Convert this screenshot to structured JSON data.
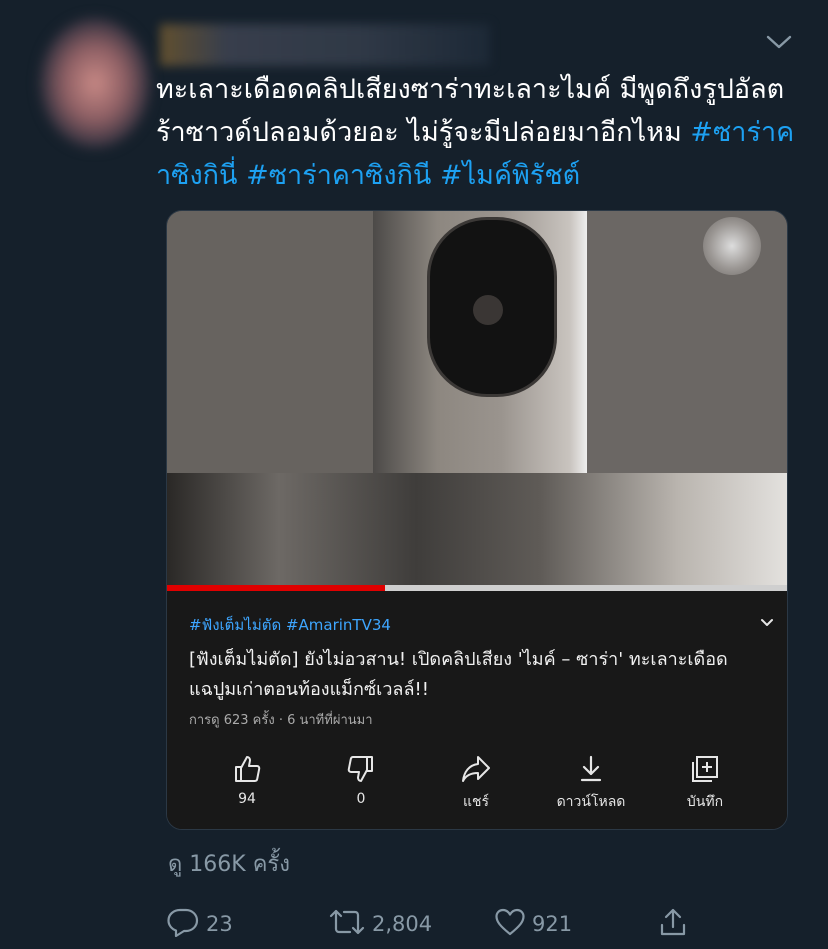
{
  "tweet": {
    "text_plain": "ทะเลาะเดือดคลิปเสียงซาร่าทะเลาะไมค์ มีพูดถึงรูปอัลตร้าซาวด์ปลอมด้วยอะ ไม่รู้จะมีปล่อยมาอีกไหม ",
    "hashtags": [
      "#ซาร่าคาซิงกินี่",
      "#ซาร่าคาซิงกินี",
      "#ไมค์พิรัชต์"
    ],
    "views_line": "ดู 166K ครั้ง"
  },
  "video_card": {
    "progress": 0.35,
    "tags": "#ฟังเต็มไม่ตัด #AmarinTV34",
    "title": "[ฟังเต็มไม่ตัด] ยังไม่อวสาน! เปิดคลิปเสียง 'ไมค์ – ซาร่า' ทะเลาะเดือด แฉปูมเก่าตอนท้องแม็กซ์เวลล์!!",
    "views": "การดู 623 ครั้ง · 6 นาทีที่ผ่านมา",
    "actions": {
      "like": "94",
      "dislike": "0",
      "share": "แชร์",
      "download": "ดาวน์โหลด",
      "save": "บันทึก"
    }
  },
  "tweet_actions": {
    "replies": "23",
    "retweets": "2,804",
    "likes": "921"
  },
  "icons": [
    "caret-down-icon",
    "thumbs-up-icon",
    "thumbs-down-icon",
    "share-arrow-icon",
    "download-icon",
    "add-to-playlist-icon",
    "reply-icon",
    "retweet-icon",
    "heart-icon",
    "share-icon"
  ],
  "colors": {
    "background": "#15202b",
    "hashtag": "#1da1f2",
    "youtube_link": "#3ea6ff",
    "progress": "#e00000",
    "muted": "#8899a6"
  }
}
